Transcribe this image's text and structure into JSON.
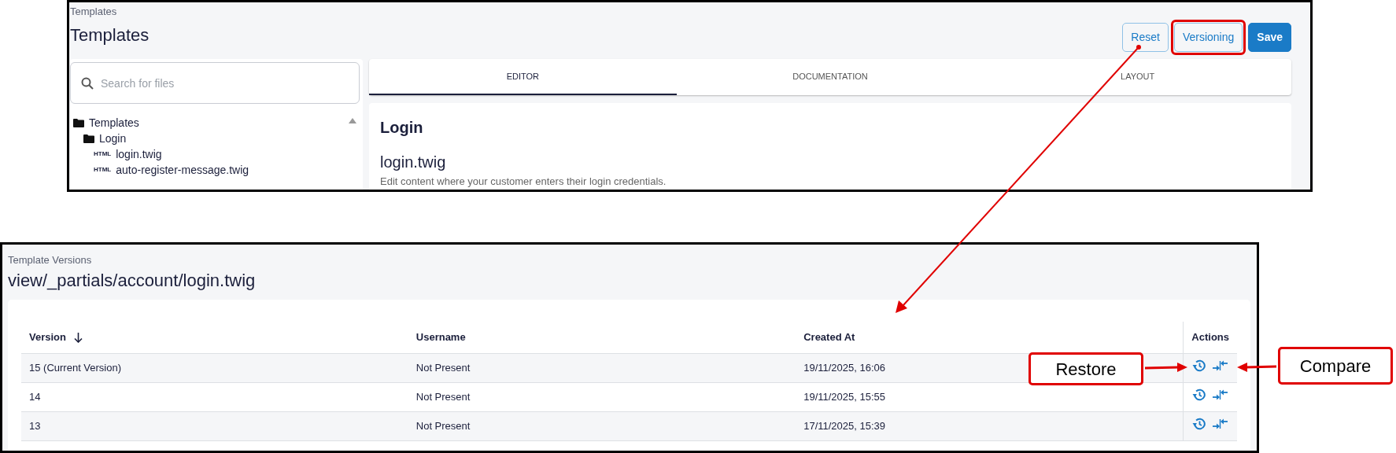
{
  "top_window": {
    "breadcrumb": "Templates",
    "title": "Templates",
    "buttons": [
      {
        "label": "Reset",
        "kind": "outline",
        "highlighted": false
      },
      {
        "label": "Versioning",
        "kind": "outline",
        "highlighted": true
      },
      {
        "label": "Save",
        "kind": "primary",
        "highlighted": false
      }
    ],
    "search": {
      "placeholder": "Search for files"
    },
    "file_tree": [
      {
        "label": "Templates",
        "kind": "folder",
        "children": [
          {
            "label": "Login",
            "kind": "folder",
            "children": [
              {
                "label": "login.twig",
                "kind": "file",
                "icon_text": "HTML"
              },
              {
                "label": "auto-register-message.twig",
                "kind": "file",
                "icon_text": "HTML"
              }
            ]
          }
        ]
      }
    ],
    "tabs": [
      {
        "label": "EDITOR",
        "selected": true
      },
      {
        "label": "DOCUMENTATION",
        "selected": false
      },
      {
        "label": "LAYOUT",
        "selected": false
      }
    ],
    "section": {
      "heading": "Login",
      "file_name": "login.twig",
      "description": "Edit content where your customer enters their login credentials."
    }
  },
  "versions_window": {
    "breadcrumb": "Template Versions",
    "title": "view/_partials/account/login.twig",
    "table": {
      "columns": [
        {
          "label": "Version",
          "sorted_descending": true
        },
        {
          "label": "Username"
        },
        {
          "label": "Created At"
        },
        {
          "label": "Actions"
        }
      ],
      "rows": [
        {
          "version": "15 (Current Version)",
          "username": "Not Present",
          "created_at": "19/11/2025, 16:06"
        },
        {
          "version": "14",
          "username": "Not Present",
          "created_at": "19/11/2025, 15:55"
        },
        {
          "version": "13",
          "username": "Not Present",
          "created_at": "17/11/2025, 15:39"
        }
      ]
    }
  },
  "callouts": [
    {
      "label": "Restore"
    },
    {
      "label": "Compare"
    }
  ]
}
